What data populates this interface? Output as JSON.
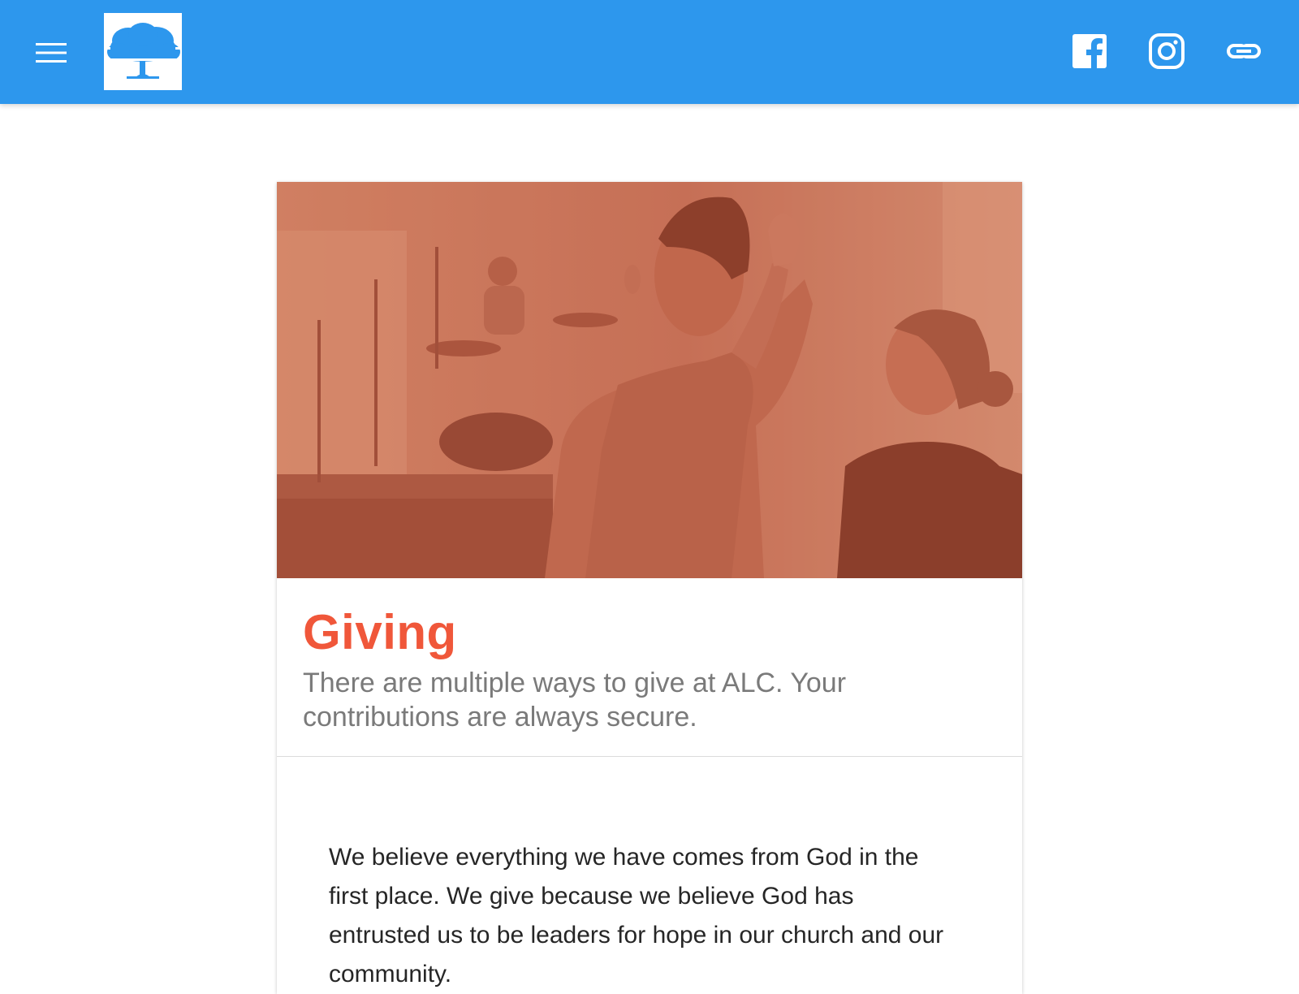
{
  "header": {
    "menu_icon": "hamburger-menu-icon",
    "logo_icon": "tree-logo",
    "social": [
      {
        "name": "facebook-icon"
      },
      {
        "name": "instagram-icon"
      },
      {
        "name": "link-icon"
      }
    ]
  },
  "colors": {
    "topbar": "#2d97ed",
    "title": "#f0573a",
    "hero_overlay": "#c0644a"
  },
  "hero": {
    "image": "worship-photo"
  },
  "card": {
    "title": "Giving",
    "subtitle": "There are multiple ways to give at ALC. Your contributions are always secure.",
    "body": "We believe everything we have comes from God in the first place. We give because we believe God has entrusted us to be leaders for hope in our church and our community."
  }
}
